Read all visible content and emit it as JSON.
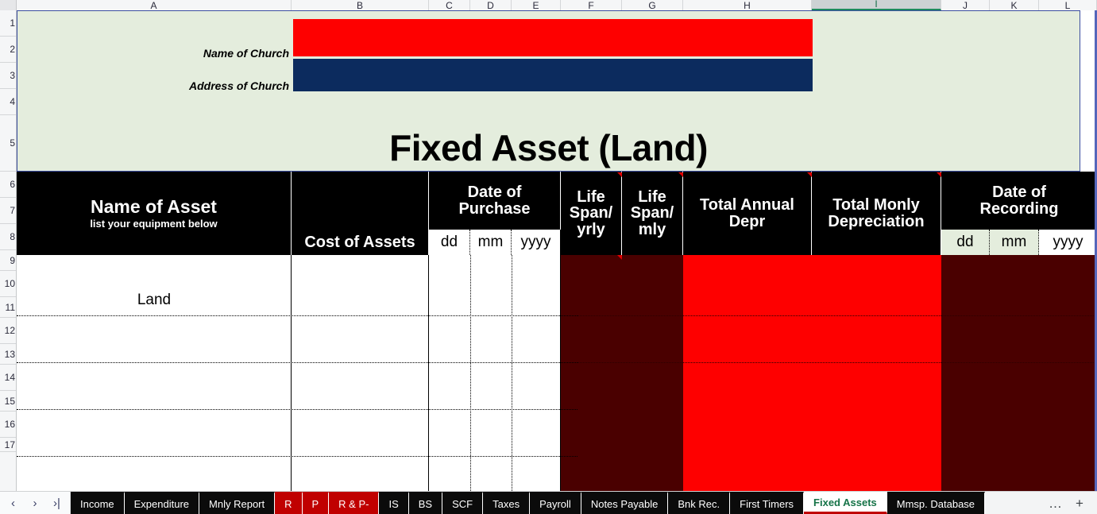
{
  "spreadsheet": {
    "columns": [
      "A",
      "B",
      "C",
      "D",
      "E",
      "F",
      "G",
      "H",
      "I",
      "J",
      "K",
      "L"
    ],
    "selected_column": "I",
    "rows": [
      "1",
      "2",
      "3",
      "4",
      "5",
      "6",
      "7",
      "8",
      "9",
      "10",
      "11",
      "12",
      "13",
      "14",
      "15",
      "16",
      "17"
    ]
  },
  "info": {
    "name_label": "Name of Church",
    "name_value": "",
    "address_label": "Address of Church",
    "address_value": "",
    "title": "Fixed Asset (Land)",
    "bg_color": "#e4eddd",
    "name_field_color": "#fe0000",
    "address_field_color": "#0c2b5e"
  },
  "table": {
    "headers": {
      "name_of_asset": "Name of Asset",
      "name_of_asset_sub": "list your equipment below",
      "cost_of_assets": "Cost of Assets",
      "date_of_purchase": "Date of Purchase",
      "life_span_yrly": "Life Span/ yrly",
      "life_span_yrly_l1": "Life",
      "life_span_yrly_l2": "Span/",
      "life_span_yrly_l3": "yrly",
      "life_span_mly_l1": "Life",
      "life_span_mly_l2": "Span/",
      "life_span_mly_l3": "mly",
      "total_annual_depr_l1": "Total Annual",
      "total_annual_depr_l2": "Depr",
      "total_monly_depr_l1": "Total Monly",
      "total_monly_depr_l2": "Depreciation",
      "date_of_recording_l1": "Date of",
      "date_of_recording_l2": "Recording",
      "dd": "dd",
      "mm": "mm",
      "yyyy": "yyyy"
    },
    "rows": [
      {
        "name_of_asset": "Land"
      },
      {
        "name_of_asset": ""
      },
      {
        "name_of_asset": ""
      },
      {
        "name_of_asset": ""
      },
      {
        "name_of_asset": ""
      },
      {
        "name_of_asset": ""
      }
    ],
    "colors": {
      "header_bg": "#000000",
      "header_text": "#ffffff",
      "data_white": "#ffffff",
      "data_maroon": "#4a0000",
      "data_red": "#fe0000"
    }
  },
  "tabbar": {
    "nav": {
      "prev": "‹",
      "next": "›",
      "last": "›|"
    },
    "tabs": [
      {
        "label": "Income",
        "style": "black",
        "active": false
      },
      {
        "label": "Expenditure",
        "style": "black",
        "active": false
      },
      {
        "label": "Mnly Report",
        "style": "black",
        "active": false
      },
      {
        "label": "R",
        "style": "red",
        "active": false
      },
      {
        "label": "P",
        "style": "red",
        "active": false
      },
      {
        "label": "R & P-",
        "style": "red",
        "active": false
      },
      {
        "label": "IS",
        "style": "black",
        "active": false
      },
      {
        "label": "BS",
        "style": "black",
        "active": false
      },
      {
        "label": "SCF",
        "style": "black",
        "active": false
      },
      {
        "label": "Taxes",
        "style": "black",
        "active": false
      },
      {
        "label": "Payroll",
        "style": "black",
        "active": false
      },
      {
        "label": "Notes Payable",
        "style": "black",
        "active": false
      },
      {
        "label": "Bnk Rec.",
        "style": "black",
        "active": false
      },
      {
        "label": "First Timers",
        "style": "black",
        "active": false
      },
      {
        "label": "Fixed Assets",
        "style": "black",
        "active": true
      },
      {
        "label": "Mmsp. Database",
        "style": "black",
        "active": false
      }
    ],
    "more": "…",
    "add": "+"
  }
}
